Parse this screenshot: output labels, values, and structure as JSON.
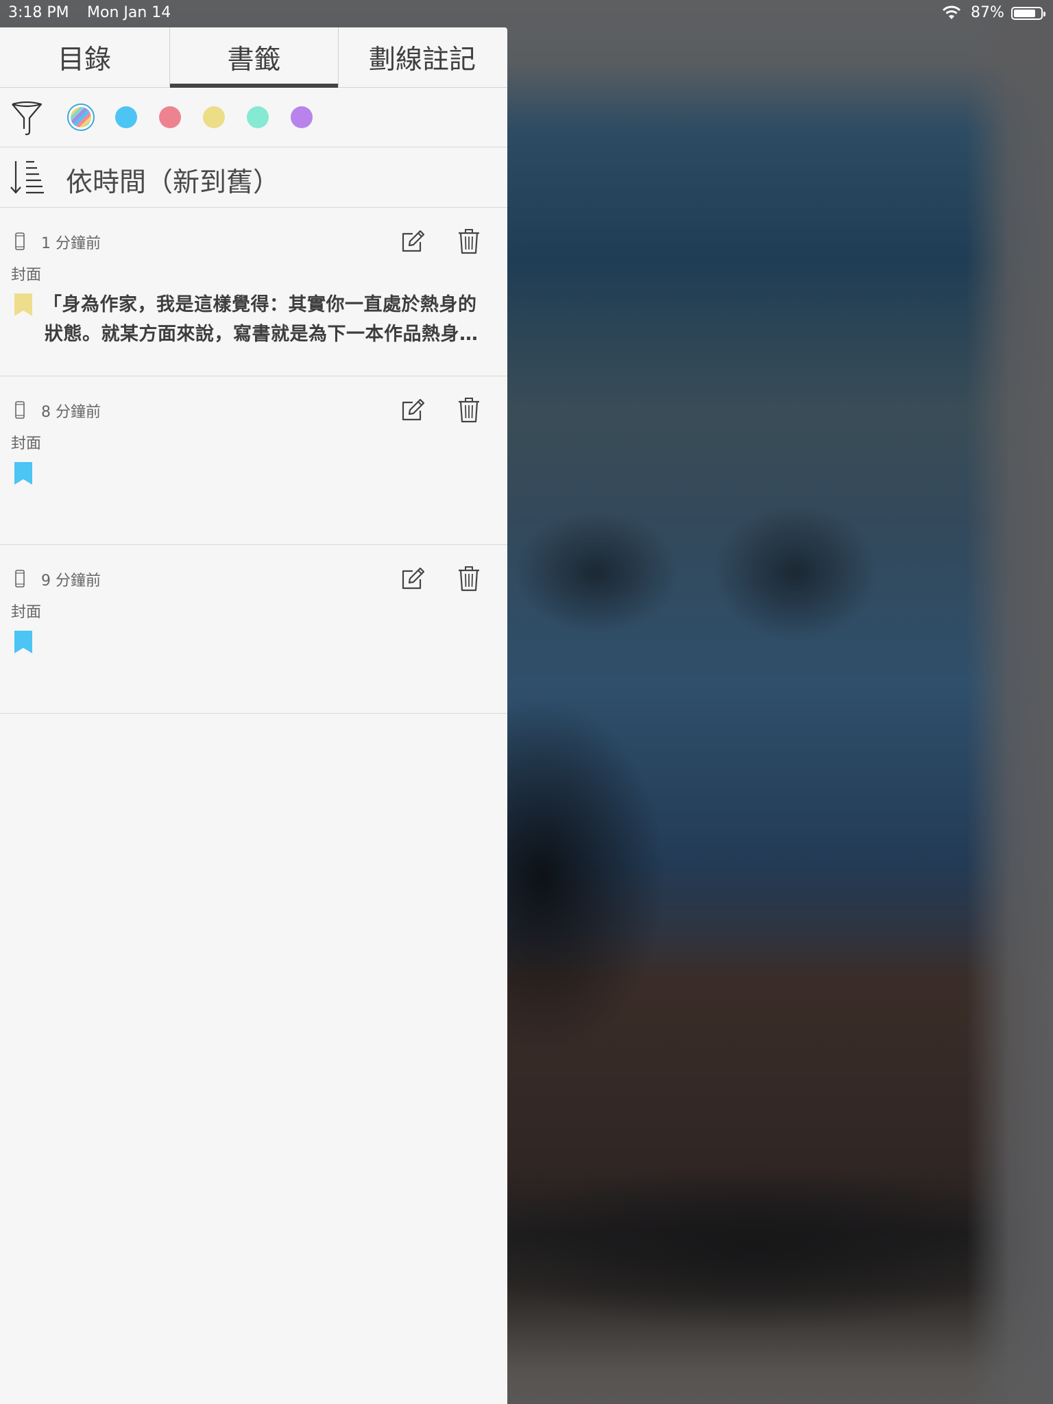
{
  "status_bar": {
    "time": "3:18 PM",
    "date": "Mon Jan 14",
    "battery_percent": "87%",
    "battery_level": 0.87
  },
  "tabs": [
    {
      "label": "目錄",
      "active": false
    },
    {
      "label": "書籤",
      "active": true
    },
    {
      "label": "劃線註記",
      "active": false
    }
  ],
  "filter": {
    "icon": "funnel-icon",
    "colors": [
      "all",
      "#4cc4f4",
      "#ed8390",
      "#ecdd87",
      "#86e9d1",
      "#b884ec"
    ],
    "selected": "all"
  },
  "sort": {
    "icon": "sort-descending-icon",
    "label": "依時間（新到舊）"
  },
  "bookmarks": [
    {
      "time": "1 分鐘前",
      "location": "封面",
      "color": "#eedd8c",
      "quote_line1": "「身為作家，我是這樣覺得：其實你一直處於熱身的",
      "quote_line2": "狀態。就某方面來說，寫書就是為下一本作品熱身…"
    },
    {
      "time": "8 分鐘前",
      "location": "封面",
      "color": "#4cc4f4",
      "quote_line1": "",
      "quote_line2": ""
    },
    {
      "time": "9 分鐘前",
      "location": "封面",
      "color": "#4cc4f4",
      "quote_line1": "",
      "quote_line2": ""
    }
  ]
}
